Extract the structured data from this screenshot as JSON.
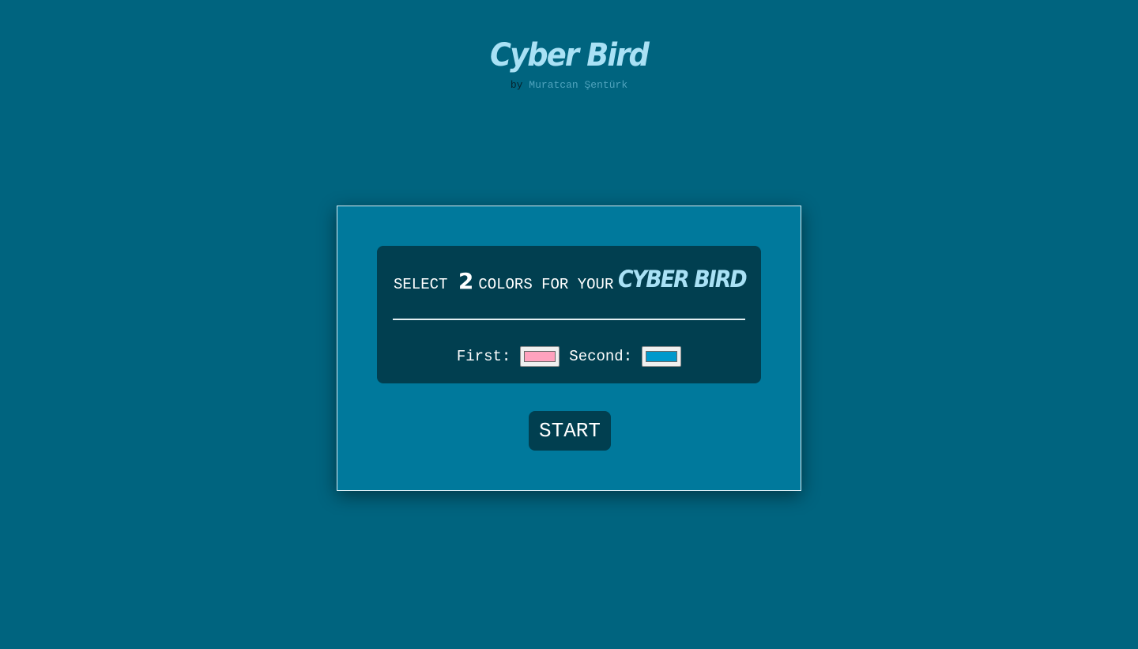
{
  "header": {
    "title": "Cyber Bird",
    "by": "by",
    "author": "Muratcan Şentürk"
  },
  "card": {
    "select_word": "SELECT",
    "count": "2",
    "rest": "COLORS FOR YOUR",
    "brand": "CYBER BIRD"
  },
  "pickers": {
    "first_label": "First:",
    "first_color": "#ffa2be",
    "second_label": "Second:",
    "second_color": "#0099cc"
  },
  "start_label": "START",
  "colors": {
    "background": "#00647f",
    "panel": "#00799c",
    "card": "#013f50",
    "title": "#a9e1f5"
  }
}
